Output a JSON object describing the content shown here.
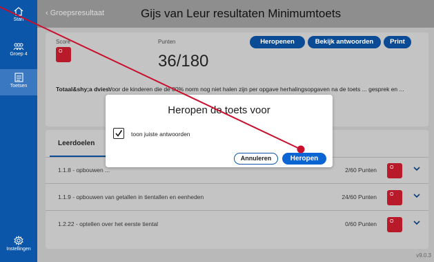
{
  "sidebar": {
    "items": [
      {
        "label": "Start",
        "icon": "home-icon"
      },
      {
        "label": "Groep 4",
        "icon": "group-icon"
      },
      {
        "label": "Toetsen",
        "icon": "test-icon"
      },
      {
        "label": "Instellingen",
        "icon": "gear-icon"
      }
    ]
  },
  "header": {
    "back_label": "Groepsresultaat",
    "title": "Gijs van Leur resultaten Minimumtoets"
  },
  "summary": {
    "score_label": "Score",
    "score_badge": "O",
    "points_label": "Punten",
    "points_value": "36/180",
    "buttons": {
      "reopen": "Heropenen",
      "view_answers": "Bekijk antwoorden",
      "print": "Print"
    },
    "advice_label": "Totaal&shy;a dvies:",
    "advice_text": "Voor de kinderen die de 80% norm nog niet halen zijn per opgave herhalingsopgaven na de toets ... gesprek en ... en te halen, anders lopen"
  },
  "goals": {
    "heading": "Leerdoelen",
    "rows": [
      {
        "label": "1.1.8 - opbouwen ...",
        "points": "2/60 Punten",
        "badge": "O"
      },
      {
        "label": "1.1.9 - opbouwen van getallen in tientallen en eenheden",
        "points": "24/60 Punten",
        "badge": "O"
      },
      {
        "label": "1.2.22 - optellen over het eerste tiental",
        "points": "0/60 Punten",
        "badge": "O"
      }
    ]
  },
  "modal": {
    "title": "Heropen de toets voor",
    "checkbox_label": "toon juiste antwoorden",
    "checkbox_checked": true,
    "cancel_label": "Annuleren",
    "confirm_label": "Heropen"
  },
  "version": "v9.0.3",
  "colors": {
    "sidebar": "#0b56a8",
    "accent": "#0b66d4",
    "badge_red": "#b81a2a",
    "annotation_line": "#c8102e"
  }
}
